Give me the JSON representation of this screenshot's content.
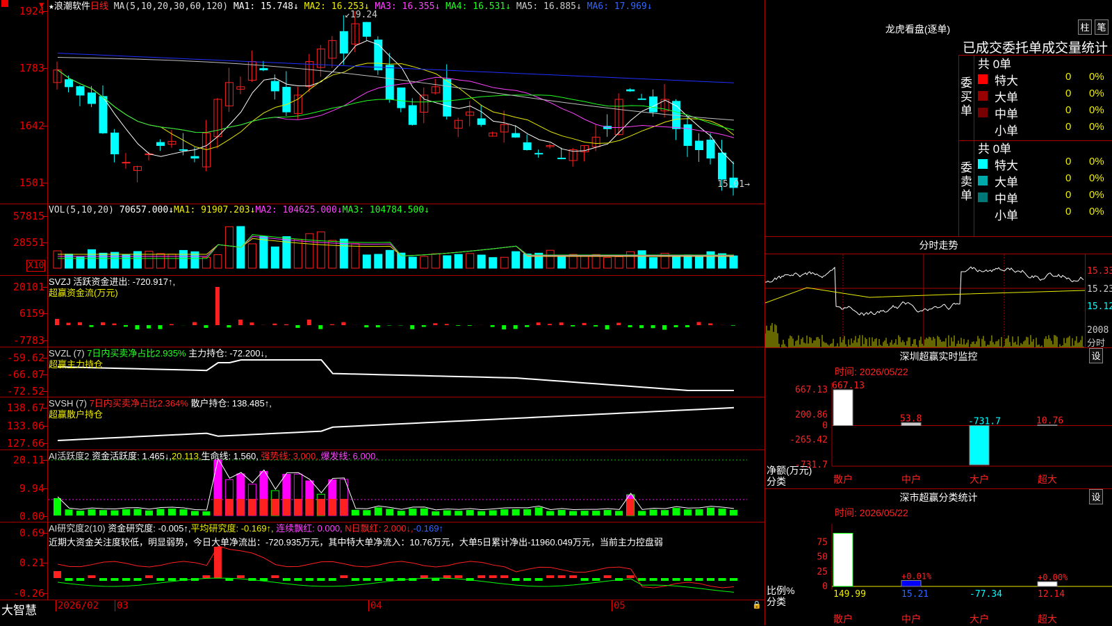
{
  "colors": {
    "up": "#ff2020",
    "down": "#00ffff",
    "grid": "#aa0000",
    "ma1": "#ffffff",
    "ma2": "#e8e800",
    "ma3": "#ff40ff",
    "ma4": "#20ff20",
    "ma5": "#c0c0c0",
    "ma6": "#2030ff",
    "green": "#00ff00",
    "magenta": "#ff00ff"
  },
  "price_pane": {
    "star": "★",
    "name": "浪潮软件",
    "period": "日线",
    "ma_params": "MA(5,10,20,30,60,120)",
    "ma1": "MA1: 15.748↓",
    "ma2": "MA2: 16.253↓",
    "ma3": "MA3: 16.355↓",
    "ma4": "MA4: 16.531↓",
    "ma5": "MA5: 16.885↓",
    "ma6": "MA6: 17.969↓",
    "ticks": [
      "1924",
      "1783",
      "1642",
      "1501"
    ],
    "high_label": "19.24",
    "low_label": "15.01"
  },
  "vol_pane": {
    "label": "VOL(5,10,20)",
    "value": "70657.000↓",
    "ma1": "MA1: 91907.203↓",
    "ma2": "MA2: 104625.000↓",
    "ma3": "MA3: 104784.500↓",
    "ticks": [
      "57815",
      "28551"
    ],
    "unit": "X10"
  },
  "svzj_pane": {
    "line1": "SVZJ  活跃资金进出: -720.917↑,",
    "line2": "超赢资金流(万元)",
    "ticks": [
      "20101",
      "6159",
      "-7783"
    ]
  },
  "svzl_pane": {
    "name": "SVZL (7)",
    "desc": "7日内买卖净占比2.935%",
    "hold": "主力持仓: -72.200↓,",
    "line2": "超赢主力持仓",
    "ticks": [
      "-59.62",
      "-66.07",
      "-72.52"
    ]
  },
  "svsh_pane": {
    "name": "SVSH (7)",
    "desc": "7日内买卖净占比2.364%",
    "hold": "散户持仓: 138.485↑,",
    "line2": "超赢散户持仓",
    "ticks": [
      "138.67",
      "133.06",
      "127.66"
    ]
  },
  "ai1_pane": {
    "name": "AI活跃度2",
    "a": "资金活跃度: 1.465↓,",
    "b": "20.113,",
    "c": "生命线: 1.560,",
    "d": "强势线: 3.000,",
    "e": "爆发线: 6.000,",
    "ticks": [
      "20.11",
      "9.94",
      "0.00"
    ]
  },
  "ai2_pane": {
    "name": "AI研究度2(10)",
    "a": "资金研究度: -0.005↑,",
    "b": "平均研究度: -0.169↑,",
    "c": "连续飘红: 0.000,",
    "d": "N日飘红: 2.000↓,",
    "e": "-0.169↑",
    "text": "近期大资金关注度较低，明显弱势，今日大单净流出：-720.935万元，其中特大单净流入：10.76万元，大单5日累计净出-11960.049万元，当前主力控盘弱",
    "ticks": [
      "0.69",
      "0.21",
      "-0.26"
    ]
  },
  "bottom_bar": {
    "brand": "大智慧",
    "dates": [
      "2026/02",
      "03",
      "04",
      "05"
    ]
  },
  "dragon": {
    "title": "龙虎看盘(逐单)",
    "btn1": "柱",
    "btn2": "笔",
    "header": "已成交委托单成交量统计",
    "buy_label": "委买单",
    "sell_label": "委卖单",
    "buy_total": "共 0单",
    "sell_total": "共 0单",
    "rows": [
      {
        "name": "特大",
        "v": "0",
        "p": "0%"
      },
      {
        "name": "大单",
        "v": "0",
        "p": "0%"
      },
      {
        "name": "中单",
        "v": "0",
        "p": "0%"
      },
      {
        "name": "小单",
        "v": "0",
        "p": "0%"
      }
    ]
  },
  "intraday": {
    "title": "分时走势",
    "ticks": [
      "15.33",
      "15.23",
      "15.12"
    ],
    "vol_tick": "2008",
    "vol_label": "分时"
  },
  "monitor": {
    "title": "深圳超赢实时监控",
    "btn": "设",
    "date": "时间: 2026/05/22",
    "ticks": [
      "667.13",
      "200.86",
      "0",
      "-265.42",
      "-731.7"
    ],
    "values": [
      "667.13",
      "53.8",
      "-731.7",
      "10.76"
    ],
    "cats": [
      "散户",
      "中户",
      "大户",
      "超大"
    ],
    "unit": "净额(万元)",
    "unit2": "分类"
  },
  "stats": {
    "title": "深市超赢分类统计",
    "btn": "设",
    "date": "时间: 2026/05/22",
    "ticks": [
      "75",
      "50",
      "25",
      "0"
    ],
    "values": [
      "149.99",
      "15.21",
      "-77.34",
      "12.14"
    ],
    "pcts": [
      "+0.01%",
      "+0.00%"
    ],
    "cats": [
      "散户",
      "中户",
      "大户",
      "超大"
    ],
    "unit": "比例%",
    "unit2": "分类"
  }
}
